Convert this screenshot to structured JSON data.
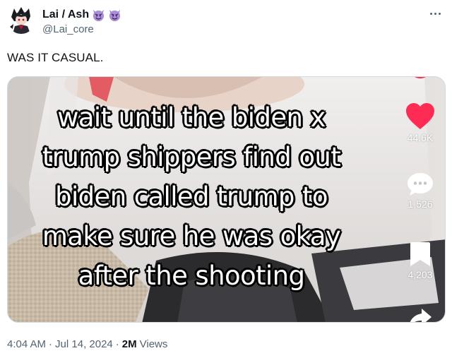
{
  "author": {
    "display_name": "Lai / Ash",
    "handle": "@Lai_core",
    "badges": [
      "smiling-imp-icon",
      "smiling-imp-icon"
    ]
  },
  "tweet": {
    "text": "WAS IT CASUAL."
  },
  "media": {
    "caption_lines": [
      "wait until the biden x",
      "trump shippers find out",
      "biden called trump to",
      "make sure he was okay",
      "after the shooting"
    ],
    "likes": "44.6K",
    "comments": "1,526",
    "saves": "4,203",
    "accent_color": "#fe2c55"
  },
  "footer": {
    "time": "4:04 AM",
    "separator": "·",
    "date": "Jul 14, 2024",
    "views_count": "2M",
    "views_label": "Views"
  },
  "colors": {
    "text_primary": "#0f1419",
    "text_secondary": "#536471",
    "border": "#cfd9de"
  }
}
